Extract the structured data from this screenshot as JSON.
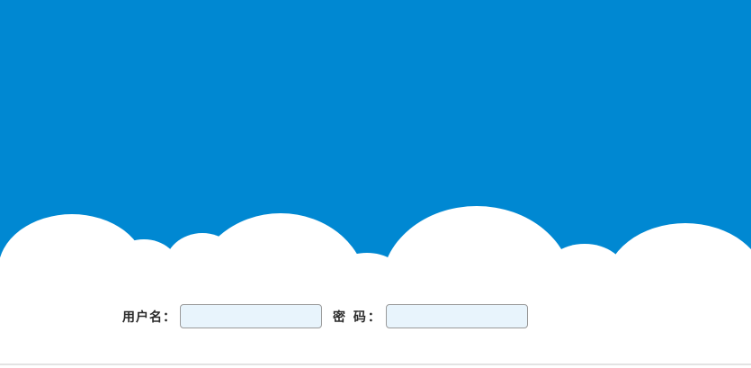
{
  "login": {
    "username_label": "用户名：",
    "username_value": "",
    "password_label": "密 码：",
    "password_value": ""
  },
  "colors": {
    "sky": "#0088d2",
    "cloud": "#ffffff",
    "input_background": "#e8f4fc"
  }
}
